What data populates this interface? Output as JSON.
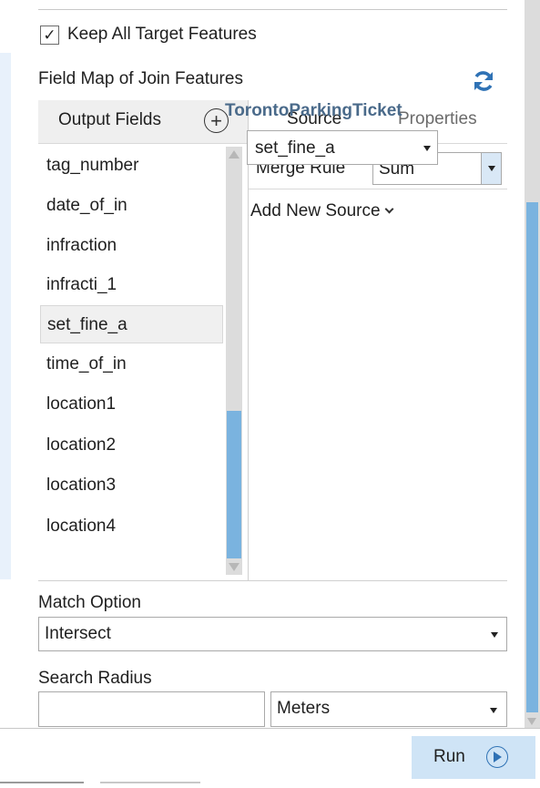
{
  "keep_all_target_features": {
    "label": "Keep All Target Features",
    "checked": true
  },
  "field_map": {
    "title": "Field Map of Join Features",
    "output_fields_label": "Output Fields",
    "fields": [
      "tag_number",
      "date_of_in",
      "infraction",
      "infracti_1",
      "set_fine_a",
      "time_of_in",
      "location1",
      "location2",
      "location3",
      "location4"
    ],
    "selected_field": "set_fine_a",
    "tabs": {
      "source": "Source",
      "properties": "Properties",
      "active": "Source"
    },
    "merge_rule_label": "Merge Rule",
    "merge_rule_value": "Sum",
    "source_name": "TorontoParkingTicket",
    "source_field_value": "set_fine_a",
    "add_new_source_label": "Add New Source"
  },
  "match_option": {
    "label": "Match Option",
    "value": "Intersect"
  },
  "search_radius": {
    "label": "Search Radius",
    "value": "",
    "unit": "Meters"
  },
  "run_button": {
    "label": "Run"
  },
  "colors": {
    "accent": "#7ab3df",
    "run_button_bg": "#cfe4f6",
    "refresh_icon": "#2f72b5",
    "source_name": "#4a6a8a"
  },
  "icons": {
    "refresh": "refresh-icon",
    "add": "plus-icon",
    "run": "play-icon"
  }
}
